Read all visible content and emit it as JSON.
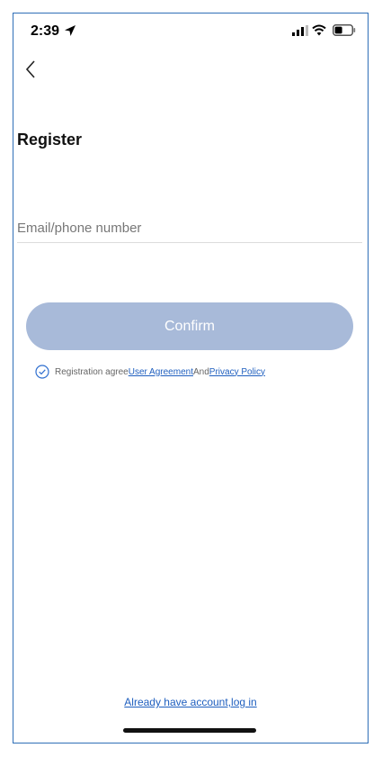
{
  "status_bar": {
    "time": "2:39"
  },
  "page": {
    "title": "Register",
    "email_placeholder": "Email/phone number",
    "confirm_label": "Confirm",
    "agreement": {
      "prefix": "Registration agree",
      "user_agreement": "User Agreement",
      "and": "And",
      "privacy_policy": "Privacy Policy"
    },
    "login_link": "Already have account,log in"
  },
  "colors": {
    "button_bg": "#a8bad9",
    "link": "#1f5fbf",
    "check": "#2f6fcf"
  },
  "icons": [
    "location-arrow-icon",
    "signal-icon",
    "wifi-icon",
    "battery-icon",
    "back-chevron-icon",
    "check-circle-icon"
  ]
}
